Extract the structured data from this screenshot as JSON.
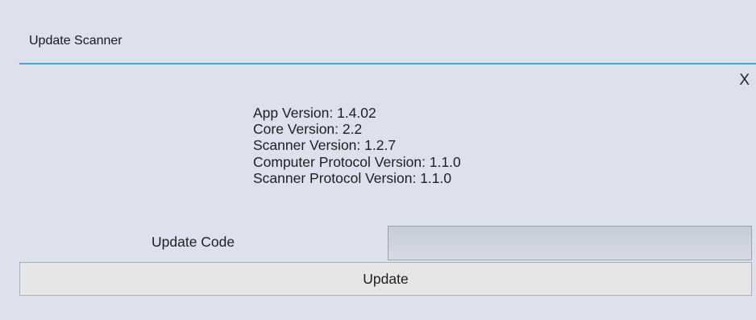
{
  "window": {
    "title": "Update Scanner",
    "close_label": "X"
  },
  "versions": {
    "app": "App Version: 1.4.02",
    "core": "Core Version: 2.2",
    "scanner": "Scanner Version: 1.2.7",
    "computer_protocol": "Computer Protocol Version: 1.1.0",
    "scanner_protocol": "Scanner Protocol Version: 1.1.0"
  },
  "form": {
    "update_code_label": "Update Code",
    "update_code_value": "",
    "update_button_label": "Update"
  },
  "colors": {
    "background": "#dde1ee",
    "title_underline": "#3aa6d6",
    "input_background": "#c6ccd8",
    "button_background": "#e6e6e6"
  }
}
